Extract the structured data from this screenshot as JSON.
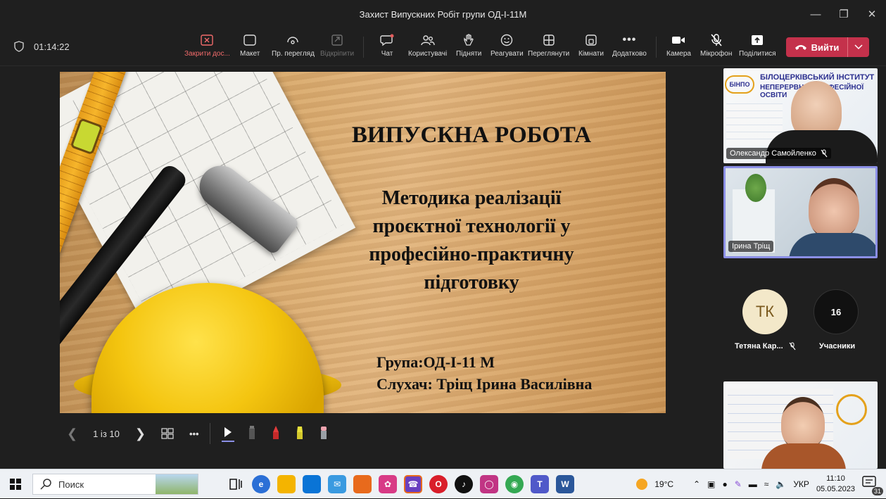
{
  "window": {
    "title": "Захист Випускних Робіт групи ОД-І-11М",
    "controls": [
      "minimize-icon",
      "maximize-icon",
      "close-icon"
    ]
  },
  "meeting": {
    "timer": "01:14:22",
    "toolbar": [
      {
        "label": "Закрити дос...",
        "icon": "close-share-icon"
      },
      {
        "label": "Макет",
        "icon": "layout-icon"
      },
      {
        "label": "Пр. перегляд",
        "icon": "preview-icon"
      },
      {
        "label": "Відкріпити",
        "icon": "unpin-icon"
      },
      {
        "label": "Чат",
        "icon": "chat-icon"
      },
      {
        "label": "Користувачі",
        "icon": "people-icon"
      },
      {
        "label": "Підняти",
        "icon": "raise-hand-icon"
      },
      {
        "label": "Реагувати",
        "icon": "react-icon"
      },
      {
        "label": "Переглянути",
        "icon": "view-icon"
      },
      {
        "label": "Кімнати",
        "icon": "rooms-icon"
      },
      {
        "label": "Додатково",
        "icon": "more-icon"
      },
      {
        "label": "Камера",
        "icon": "camera-icon"
      },
      {
        "label": "Мікрофон",
        "icon": "mic-off-icon"
      },
      {
        "label": "Поділитися",
        "icon": "share-icon"
      }
    ],
    "leave_label": "Вийти"
  },
  "slide": {
    "heading": "ВИПУСКНА РОБОТА",
    "topic_lines": [
      "Методика реалізації",
      "проєктної технології у",
      "професійно-практичну",
      "підготовку"
    ],
    "group": "Група:ОД-І-11 М",
    "student": "Слухач: Тріщ Ірина Василівна",
    "page_indicator": "1 із 10"
  },
  "participants": {
    "tile1_name": "Олександр Самойленко",
    "tile1_banner": [
      "БІЛОЦЕРКІВСЬКИЙ ІНСТИТУТ",
      "НЕПЕРЕРВНОЇ ПРОФЕСІЙНОЇ ОСВІТИ"
    ],
    "tile1_logo": "БІНПО",
    "tile2_name": "Ірина Тріщ",
    "avatar_initials": "ТК",
    "avatar_name": "Тетяна Кар...",
    "count": "16",
    "count_label": "Учасники"
  },
  "taskbar": {
    "search_placeholder": "Поиск",
    "weather": "19°C",
    "language": "УКР",
    "time": "11:10",
    "date": "05.05.2023",
    "notifications": "31",
    "app_colors": [
      "#2b6fd6",
      "#f4b400",
      "#0a74d6",
      "#3a9ae0",
      "#e86a1c",
      "#d83b86",
      "#6a3fbf",
      "#d91e2a",
      "#111111",
      "#c13584",
      "#34a853",
      "#5059c9",
      "#2b579a"
    ]
  }
}
